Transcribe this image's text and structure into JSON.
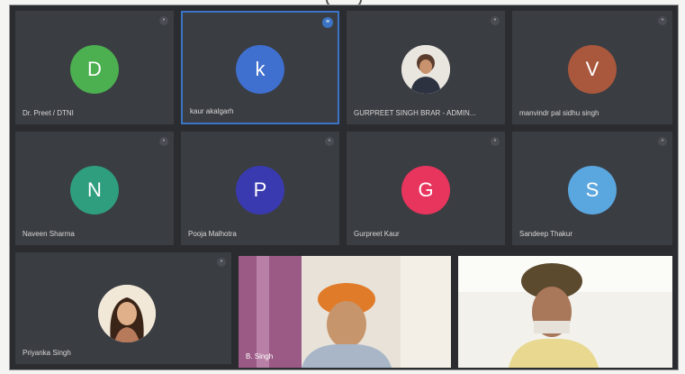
{
  "participants": [
    {
      "initial": "D",
      "name": "Dr. Preet / DTNI",
      "color": "#4caf50"
    },
    {
      "initial": "k",
      "name": "kaur akalgarh",
      "color": "#3f6fcf"
    },
    {
      "initial": "",
      "name": "GURPREET SINGH BRAR - ADMIN...",
      "color": "#e9e6e0"
    },
    {
      "initial": "V",
      "name": "manvindr pal sidhu singh",
      "color": "#a9583d"
    },
    {
      "initial": "N",
      "name": "Naveen Sharma",
      "color": "#2e9e7e"
    },
    {
      "initial": "P",
      "name": "Pooja Malhotra",
      "color": "#3a3ab0"
    },
    {
      "initial": "G",
      "name": "Gurpreet Kaur",
      "color": "#e8355d"
    },
    {
      "initial": "S",
      "name": "Sandeep Thakur",
      "color": "#5aa6de"
    },
    {
      "initial": "",
      "name": "Priyanka Singh",
      "color": "#e9e6e0"
    },
    {
      "initial": "",
      "name": "B. Singh",
      "color": ""
    },
    {
      "initial": "",
      "name": "",
      "color": ""
    }
  ]
}
